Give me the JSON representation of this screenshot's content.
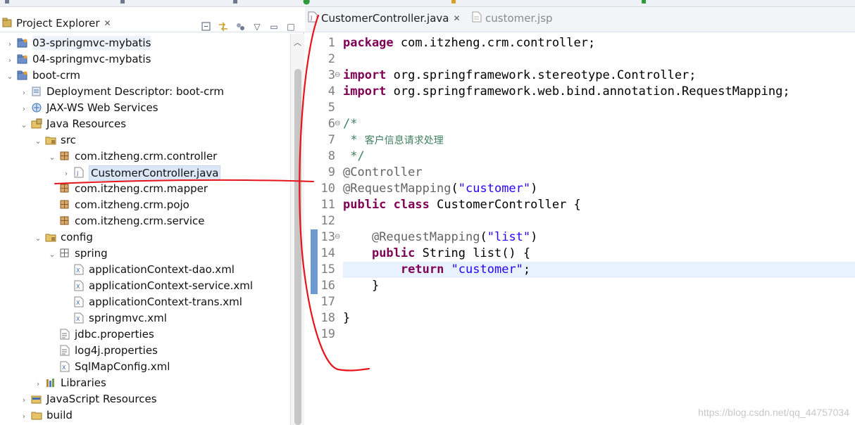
{
  "explorer": {
    "title": "Project Explorer",
    "close_glyph": "✕",
    "tree": [
      {
        "label": "03-springmvc-mybatis",
        "icon": "project-icon",
        "depth": 0,
        "expanded": false,
        "highlight": true
      },
      {
        "label": "04-springmvc-mybatis",
        "icon": "project-icon",
        "depth": 0,
        "expanded": false
      },
      {
        "label": "boot-crm",
        "icon": "project-icon",
        "depth": 0,
        "expanded": true
      },
      {
        "label": "Deployment Descriptor: boot-crm",
        "icon": "deployment-descriptor-icon",
        "depth": 1,
        "expanded": false
      },
      {
        "label": "JAX-WS Web Services",
        "icon": "web-services-icon",
        "depth": 1,
        "expanded": false
      },
      {
        "label": "Java Resources",
        "icon": "java-resources-icon",
        "depth": 1,
        "expanded": true
      },
      {
        "label": "src",
        "icon": "source-folder-icon",
        "depth": 2,
        "expanded": true
      },
      {
        "label": "com.itzheng.crm.controller",
        "icon": "package-icon",
        "depth": 3,
        "expanded": true
      },
      {
        "label": "CustomerController.java",
        "icon": "java-file-icon",
        "depth": 4,
        "expanded": false,
        "selected": true
      },
      {
        "label": "com.itzheng.crm.mapper",
        "icon": "package-icon",
        "depth": 3,
        "leaf": true
      },
      {
        "label": "com.itzheng.crm.pojo",
        "icon": "package-icon",
        "depth": 3,
        "leaf": true
      },
      {
        "label": "com.itzheng.crm.service",
        "icon": "package-icon",
        "depth": 3,
        "leaf": true
      },
      {
        "label": "config",
        "icon": "source-folder-icon",
        "depth": 2,
        "expanded": true
      },
      {
        "label": "spring",
        "icon": "empty-package-icon",
        "depth": 3,
        "expanded": true
      },
      {
        "label": "applicationContext-dao.xml",
        "icon": "xml-file-icon",
        "depth": 4,
        "leaf": true
      },
      {
        "label": "applicationContext-service.xml",
        "icon": "xml-file-icon",
        "depth": 4,
        "leaf": true
      },
      {
        "label": "applicationContext-trans.xml",
        "icon": "xml-file-icon",
        "depth": 4,
        "leaf": true
      },
      {
        "label": "springmvc.xml",
        "icon": "xml-file-icon",
        "depth": 4,
        "leaf": true
      },
      {
        "label": "jdbc.properties",
        "icon": "properties-file-icon",
        "depth": 3,
        "leaf": true
      },
      {
        "label": "log4j.properties",
        "icon": "properties-file-icon",
        "depth": 3,
        "leaf": true
      },
      {
        "label": "SqlMapConfig.xml",
        "icon": "xml-file-icon",
        "depth": 3,
        "leaf": true
      },
      {
        "label": "Libraries",
        "icon": "libraries-icon",
        "depth": 2,
        "expanded": false
      },
      {
        "label": "JavaScript Resources",
        "icon": "javascript-resources-icon",
        "depth": 1,
        "expanded": false
      },
      {
        "label": "build",
        "icon": "folder-icon",
        "depth": 1,
        "expanded": false
      }
    ]
  },
  "editor": {
    "tabs": [
      {
        "label": "CustomerController.java",
        "active": true,
        "close_glyph": "✕"
      },
      {
        "label": "customer.jsp",
        "active": false
      }
    ],
    "current_line": 15,
    "lines": [
      {
        "n": "1",
        "tokens": [
          {
            "t": "package",
            "c": "kw"
          },
          {
            "t": " com.itzheng.crm.controller;",
            "c": ""
          }
        ]
      },
      {
        "n": "2",
        "tokens": []
      },
      {
        "n": "3",
        "fold": true,
        "tokens": [
          {
            "t": "import",
            "c": "kw"
          },
          {
            "t": " org.springframework.stereotype.Controller;",
            "c": ""
          }
        ]
      },
      {
        "n": "4",
        "tokens": [
          {
            "t": "import",
            "c": "kw"
          },
          {
            "t": " org.springframework.web.bind.annotation.RequestMapping;",
            "c": ""
          }
        ]
      },
      {
        "n": "5",
        "tokens": []
      },
      {
        "n": "6",
        "fold": true,
        "tokens": [
          {
            "t": "/*",
            "c": "cmt"
          }
        ]
      },
      {
        "n": "7",
        "tokens": [
          {
            "t": " * ",
            "c": "cmt"
          },
          {
            "t": "客户信息请求处理",
            "c": "cmt cmt-cn"
          }
        ]
      },
      {
        "n": "8",
        "tokens": [
          {
            "t": " */",
            "c": "cmt"
          }
        ]
      },
      {
        "n": "9",
        "tokens": [
          {
            "t": "@Controller",
            "c": "ann"
          }
        ]
      },
      {
        "n": "10",
        "tokens": [
          {
            "t": "@RequestMapping",
            "c": "ann"
          },
          {
            "t": "(",
            "c": ""
          },
          {
            "t": "\"customer\"",
            "c": "str"
          },
          {
            "t": ")",
            "c": ""
          }
        ]
      },
      {
        "n": "11",
        "tokens": [
          {
            "t": "public",
            "c": "kw"
          },
          {
            "t": " ",
            "c": ""
          },
          {
            "t": "class",
            "c": "kw"
          },
          {
            "t": " CustomerController {",
            "c": ""
          }
        ]
      },
      {
        "n": "12",
        "tokens": []
      },
      {
        "n": "13",
        "fold": true,
        "marker": true,
        "tokens": [
          {
            "t": "    ",
            "c": ""
          },
          {
            "t": "@RequestMapping",
            "c": "ann"
          },
          {
            "t": "(",
            "c": ""
          },
          {
            "t": "\"list\"",
            "c": "str"
          },
          {
            "t": ")",
            "c": ""
          }
        ]
      },
      {
        "n": "14",
        "marker": true,
        "tokens": [
          {
            "t": "    ",
            "c": ""
          },
          {
            "t": "public",
            "c": "kw"
          },
          {
            "t": " String list() {",
            "c": ""
          }
        ]
      },
      {
        "n": "15",
        "marker": true,
        "tokens": [
          {
            "t": "        ",
            "c": ""
          },
          {
            "t": "return",
            "c": "kw"
          },
          {
            "t": " ",
            "c": ""
          },
          {
            "t": "\"customer\"",
            "c": "str"
          },
          {
            "t": ";",
            "c": ""
          }
        ]
      },
      {
        "n": "16",
        "marker": true,
        "tokens": [
          {
            "t": "    }",
            "c": ""
          }
        ]
      },
      {
        "n": "17",
        "tokens": []
      },
      {
        "n": "18",
        "tokens": [
          {
            "t": "}",
            "c": ""
          }
        ]
      },
      {
        "n": "19",
        "tokens": []
      }
    ]
  },
  "watermark": "https://blog.csdn.net/qq_44757034",
  "colors": {
    "keyword": "#7f0055",
    "annotation": "#646464",
    "string": "#2a00ff",
    "comment": "#3f7f5f",
    "annotation_pen": "#e8141c"
  }
}
